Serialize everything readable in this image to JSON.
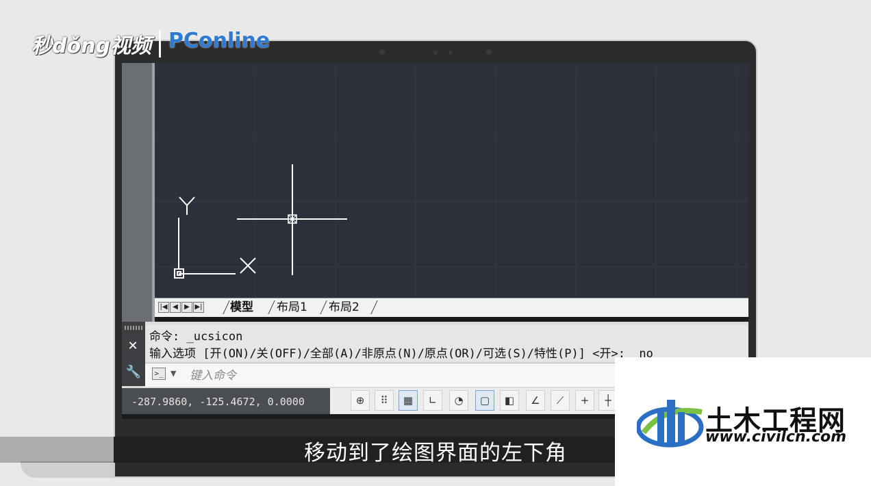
{
  "watermark": {
    "brand_left": "秒dǒng视频",
    "brand_right": "PConline"
  },
  "drawing": {
    "ucs_y_label": "Y",
    "ucs_x_label": "X"
  },
  "layout_tabs": {
    "nav_buttons": [
      "|◀",
      "◀",
      "▶",
      "▶|"
    ],
    "tabs": [
      "模型",
      "布局1",
      "布局2"
    ],
    "active_tab": "模型"
  },
  "command_window": {
    "line1": "命令: _ucsicon",
    "line2": "输入选项 [开(ON)/关(OFF)/全部(A)/非原点(N)/原点(OR)/可选(S)/特性(P)] <开>: _no",
    "prompt_icon": ">_",
    "placeholder": "键入命令",
    "close_symbol": "✕",
    "settings_symbol": "🔧"
  },
  "status_bar": {
    "coordinates": "-287.9860,  -125.4672,  0.0000",
    "buttons": [
      {
        "icon": "infer-constraints-icon",
        "glyph": "⊕",
        "on": false
      },
      {
        "icon": "snap-mode-icon",
        "glyph": "⠿",
        "on": false
      },
      {
        "icon": "grid-display-icon",
        "glyph": "▦",
        "on": true
      },
      {
        "icon": "ortho-mode-icon",
        "glyph": "∟",
        "on": false
      },
      {
        "icon": "polar-tracking-icon",
        "glyph": "◔",
        "on": false
      },
      {
        "icon": "osnap-icon",
        "glyph": "▢",
        "on": true
      },
      {
        "icon": "3d-osnap-icon",
        "glyph": "◧",
        "on": false
      },
      {
        "icon": "object-snap-tracking-icon",
        "glyph": "∠",
        "on": false
      },
      {
        "icon": "dynamic-ucs-icon",
        "glyph": "⟋",
        "on": false
      },
      {
        "icon": "dynamic-input-icon",
        "glyph": "+",
        "on": false
      },
      {
        "icon": "lineweight-icon",
        "glyph": "┼",
        "on": false
      }
    ]
  },
  "subtitle": "移动到了绘图界面的左下角",
  "corner_logo": {
    "name_cn": "土木工程网",
    "url": "www.civilcn.com"
  }
}
